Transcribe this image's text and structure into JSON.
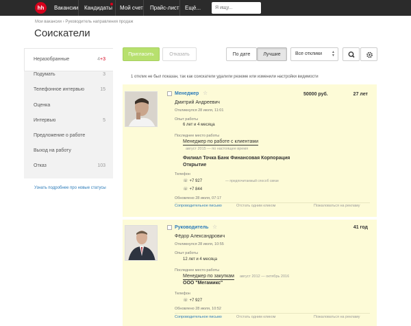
{
  "header": {
    "logo": "hh",
    "nav": [
      "Вакансии",
      "Кандидаты",
      "Мой счет",
      "Прайс-лист",
      "Ещё..."
    ],
    "search_placeholder": "Я ищу..."
  },
  "breadcrumb": "Мои вакансии › Руководитель направления продаж",
  "page_title": "Соискатели",
  "sidebar": {
    "items": [
      {
        "label": "Неразобранные",
        "count": "4",
        "new_count": "+3"
      },
      {
        "label": "Подумать",
        "count": "3"
      },
      {
        "label": "Телефонное интервью",
        "count": "15"
      },
      {
        "label": "Оценка",
        "count": ""
      },
      {
        "label": "Интервью",
        "count": "5"
      },
      {
        "label": "Предложение о работе",
        "count": ""
      },
      {
        "label": "Выход на работу",
        "count": ""
      },
      {
        "label": "Отказ",
        "count": "103"
      }
    ],
    "learn_more": "Узнать подробнее про новые статусы"
  },
  "toolbar": {
    "invite": "Пригласить",
    "reject": "Отказать",
    "sort_date": "По дате",
    "sort_best": "Лучшие",
    "filter": "Все отклики",
    "search_icon": "search-icon",
    "settings_icon": "gear-icon"
  },
  "notice": "1 отклик не был показан, так как соискатели удалили резюме или изменили настройки видимости",
  "candidates": [
    {
      "position": "Менеджер",
      "salary": "50000 руб.",
      "age": "27 лет",
      "name": "Дмитрий Андреевич",
      "responded": "Откликнулся 28 июля, 11:01",
      "exp_label": "Опыт работы",
      "experience": "6 лет и 4 месяца",
      "last_job_label": "Последнее место работы",
      "last_job": "Менеджер по работе с клиентами",
      "last_job_dates": "август 2015 — по настоящее время",
      "company": "Филиал Точка Банк Финансовая Корпорация Открытие",
      "phone_label": "Телефон",
      "phones": [
        "+7 927",
        "+7 844"
      ],
      "phone_pref": "— предпочитаемый способ связи",
      "updated": "Обновлено 28 июля, 07:17",
      "actions": [
        "Сопроводительное письмо",
        "Отстать одним кликом",
        "Пожаловаться на рекламу"
      ]
    },
    {
      "position": "Руководитель",
      "age": "41 год",
      "name": "Фёдор Александрович",
      "responded": "Откликнулся 28 июля, 10:55",
      "exp_label": "Опыт работы",
      "experience": "12 лет и 4 месяца",
      "last_job_label": "Последнее место работы",
      "last_job": "Менеджер по закупкам",
      "last_job_dates": "август 2012 — октябрь 2016",
      "company": "ООО \"Мегамикс\"",
      "phone_label": "Телефон",
      "phones": [
        "+7 927"
      ],
      "updated": "Обновлено 28 июля, 10:52",
      "actions": [
        "Сопроводительное письмо",
        "Отстать одним кликом",
        "Пожаловаться на рекламу"
      ]
    }
  ],
  "colors": {
    "header_bg": "#2b2b2b",
    "brand_red": "#d6001c",
    "link_blue": "#2b7bb9",
    "invite_green": "#b7e06e",
    "card_bg": "#fdfbd7"
  }
}
